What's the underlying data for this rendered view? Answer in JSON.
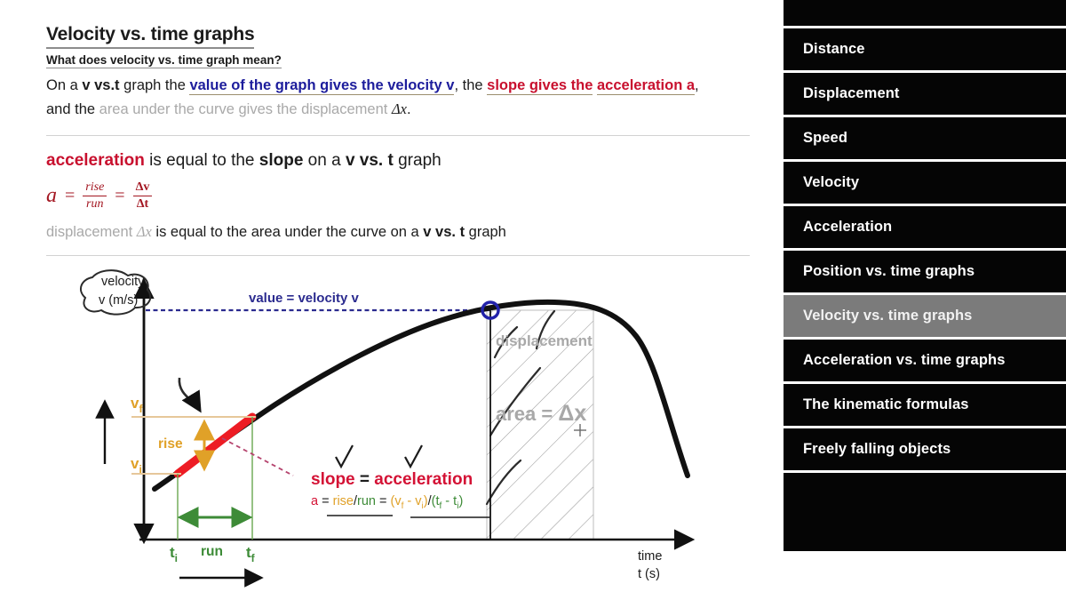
{
  "lesson": {
    "title": "Velocity vs. time graphs",
    "question": "What does velocity vs. time graph mean?",
    "intro": {
      "p1": "On a ",
      "vvst": "v vs.t",
      "p2": " graph the ",
      "blue": "value of the graph gives the velocity v",
      "p3": ", the ",
      "red1": "slope gives the",
      "red2": "acceleration a",
      "p4": ", and the ",
      "grayed": "area under the curve gives the displacement",
      "dx": "Δx",
      "period": "."
    },
    "accel_line": {
      "word_accel": "acceleration",
      "mid": " is equal to the ",
      "word_slope": "slope",
      "mid2": " on a ",
      "vvst": "v vs. t",
      "end": " graph"
    },
    "formula": {
      "a": "a",
      "eq1": "=",
      "rise": "rise",
      "run": "run",
      "eq2": "=",
      "dv": "Δv",
      "dt": "Δt"
    },
    "disp_line": {
      "word_disp": "displacement",
      "dx": "Δx",
      "mid": " is equal to the area under the curve on a ",
      "vvst": "v vs. t",
      "end": " graph"
    }
  },
  "graph": {
    "y_axis_label_line1": "velocity",
    "y_axis_label_line2": "v (m/s)",
    "x_axis_label_line1": "time",
    "x_axis_label_line2": "t (s)",
    "value_label": "value = velocity v",
    "vf": "v",
    "vf_sub": "f",
    "vi": "v",
    "vi_sub": "i",
    "rise": "rise",
    "run": "run",
    "ti": "t",
    "ti_sub": "i",
    "tf": "t",
    "tf_sub": "f",
    "slope_label_a": "slope",
    "slope_label_b": " = ",
    "slope_label_c": "acceleration",
    "slope_formula": {
      "a": "a",
      "eq1": " = ",
      "rise": "rise",
      "slash1": "/",
      "run": "run",
      "eq2": " = ",
      "open": "(v",
      "f1": "f",
      "minus1": " - v",
      "i1": "i",
      "close1": ")/(t",
      "f2": "f",
      "minus2": " - t",
      "i2": "i",
      "close2": ")"
    },
    "displacement_label": "displacement",
    "area_label_a": "area = ",
    "area_label_b": "Δx",
    "colors": {
      "curve": "#111111",
      "tangent_red": "#ed1c24",
      "rise_gold": "#e0a128",
      "run_green": "#3d8b37",
      "value_blue": "#2b2b8f",
      "slope_red": "#d41235",
      "hatch_gray": "#9a9a9a",
      "area_text_gray": "#a8a8a8"
    }
  },
  "sidebar": {
    "items": [
      {
        "label": "Distance",
        "active": false
      },
      {
        "label": "Displacement",
        "active": false
      },
      {
        "label": "Speed",
        "active": false
      },
      {
        "label": "Velocity",
        "active": false
      },
      {
        "label": "Acceleration",
        "active": false
      },
      {
        "label": "Position vs. time graphs",
        "active": false
      },
      {
        "label": "Velocity vs. time graphs",
        "active": true
      },
      {
        "label": "Acceleration vs. time graphs",
        "active": false
      },
      {
        "label": "The kinematic formulas",
        "active": false
      },
      {
        "label": "Freely falling objects",
        "active": false
      }
    ]
  }
}
